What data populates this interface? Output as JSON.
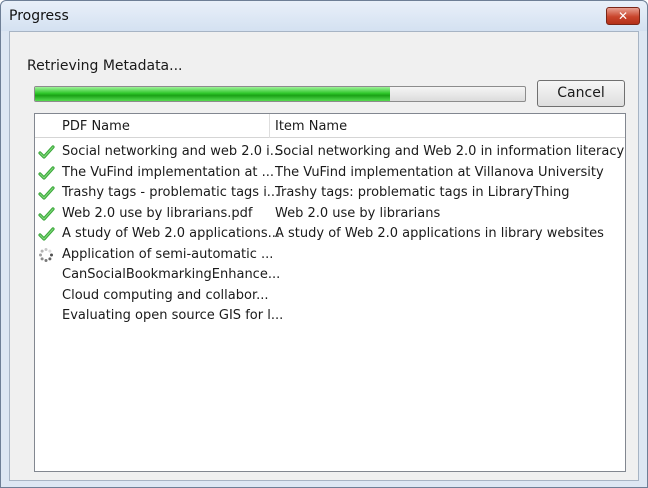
{
  "window": {
    "title": "Progress",
    "close_icon": "close-icon",
    "close_color": "#c9452c"
  },
  "status_text": "Retrieving Metadata...",
  "progress": {
    "fraction": 0.725
  },
  "cancel_label": "Cancel",
  "columns": [
    "PDF Name",
    "Item Name"
  ],
  "rows": [
    {
      "status": "done",
      "pdf": "Social networking and web 2.0 i...",
      "item": "Social networking and Web 2.0 in information literacy"
    },
    {
      "status": "done",
      "pdf": "The VuFind implementation at ...",
      "item": "The VuFind implementation at Villanova University"
    },
    {
      "status": "done",
      "pdf": "Trashy tags - problematic tags i...",
      "item": "Trashy tags: problematic tags in LibraryThing"
    },
    {
      "status": "done",
      "pdf": "Web 2.0 use by librarians.pdf",
      "item": "Web 2.0 use by librarians"
    },
    {
      "status": "done",
      "pdf": "A study of Web 2.0 applications...",
      "item": "A study of Web 2.0 applications in library websites"
    },
    {
      "status": "loading",
      "pdf": "Application of semi-automatic ...",
      "item": ""
    },
    {
      "status": "pending",
      "pdf": "CanSocialBookmarkingEnhance...",
      "item": ""
    },
    {
      "status": "pending",
      "pdf": "Cloud computing and collabor...",
      "item": ""
    },
    {
      "status": "pending",
      "pdf": "Evaluating open source GIS for l...",
      "item": ""
    }
  ],
  "colors": {
    "progress_green": "#2fc72a",
    "check_green": "#3aa63a"
  }
}
